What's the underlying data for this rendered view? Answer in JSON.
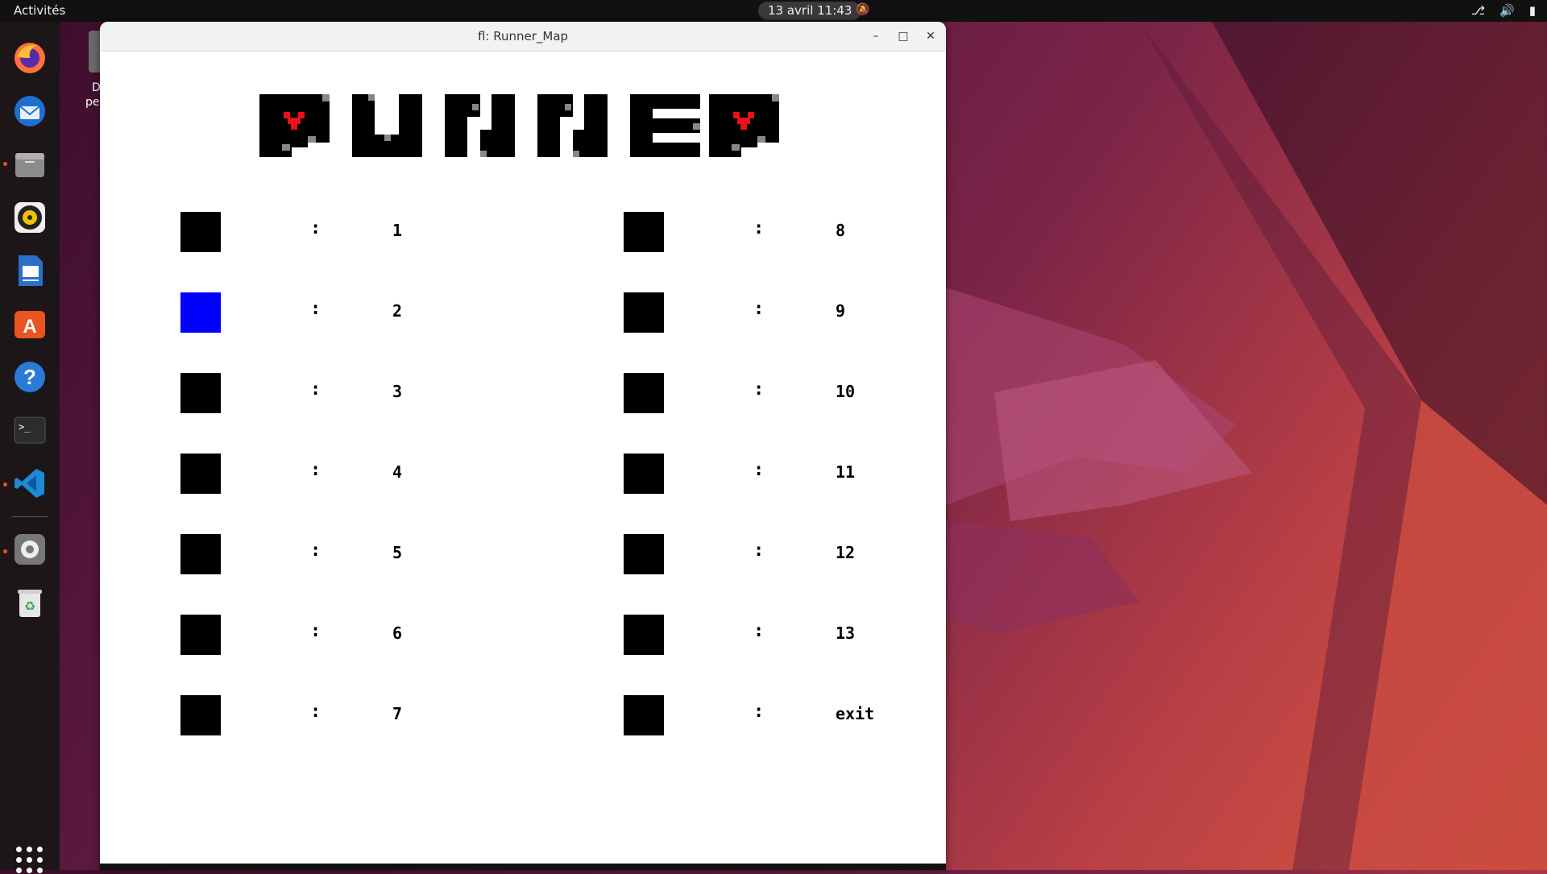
{
  "topbar": {
    "activities": "Activités",
    "clock": "13 avril  11:43"
  },
  "desktop": {
    "partial_label_1": "D",
    "partial_label_2": "pe"
  },
  "window": {
    "title": "fl: Runner_Map",
    "minimize": "–",
    "maximize": "□",
    "close": "✕"
  },
  "logo": {
    "text": "RUNNER",
    "heart_color": "#e8101a"
  },
  "maps": {
    "left": [
      {
        "label": "1",
        "color": "#000000"
      },
      {
        "label": "2",
        "color": "#0000ff"
      },
      {
        "label": "3",
        "color": "#000000"
      },
      {
        "label": "4",
        "color": "#000000"
      },
      {
        "label": "5",
        "color": "#000000"
      },
      {
        "label": "6",
        "color": "#000000"
      },
      {
        "label": "7",
        "color": "#000000"
      }
    ],
    "right": [
      {
        "label": "8",
        "color": "#000000"
      },
      {
        "label": "9",
        "color": "#000000"
      },
      {
        "label": "10",
        "color": "#000000"
      },
      {
        "label": "11",
        "color": "#000000"
      },
      {
        "label": "12",
        "color": "#000000"
      },
      {
        "label": "13",
        "color": "#000000"
      },
      {
        "label": "exit",
        "color": "#000000"
      }
    ],
    "separator": ":"
  },
  "dock": {
    "items": [
      "firefox-icon",
      "thunderbird-icon",
      "files-icon",
      "rhythmbox-icon",
      "writer-icon",
      "software-icon",
      "help-icon",
      "terminal-icon",
      "vscode-icon",
      "settings-icon",
      "trash-icon"
    ]
  }
}
